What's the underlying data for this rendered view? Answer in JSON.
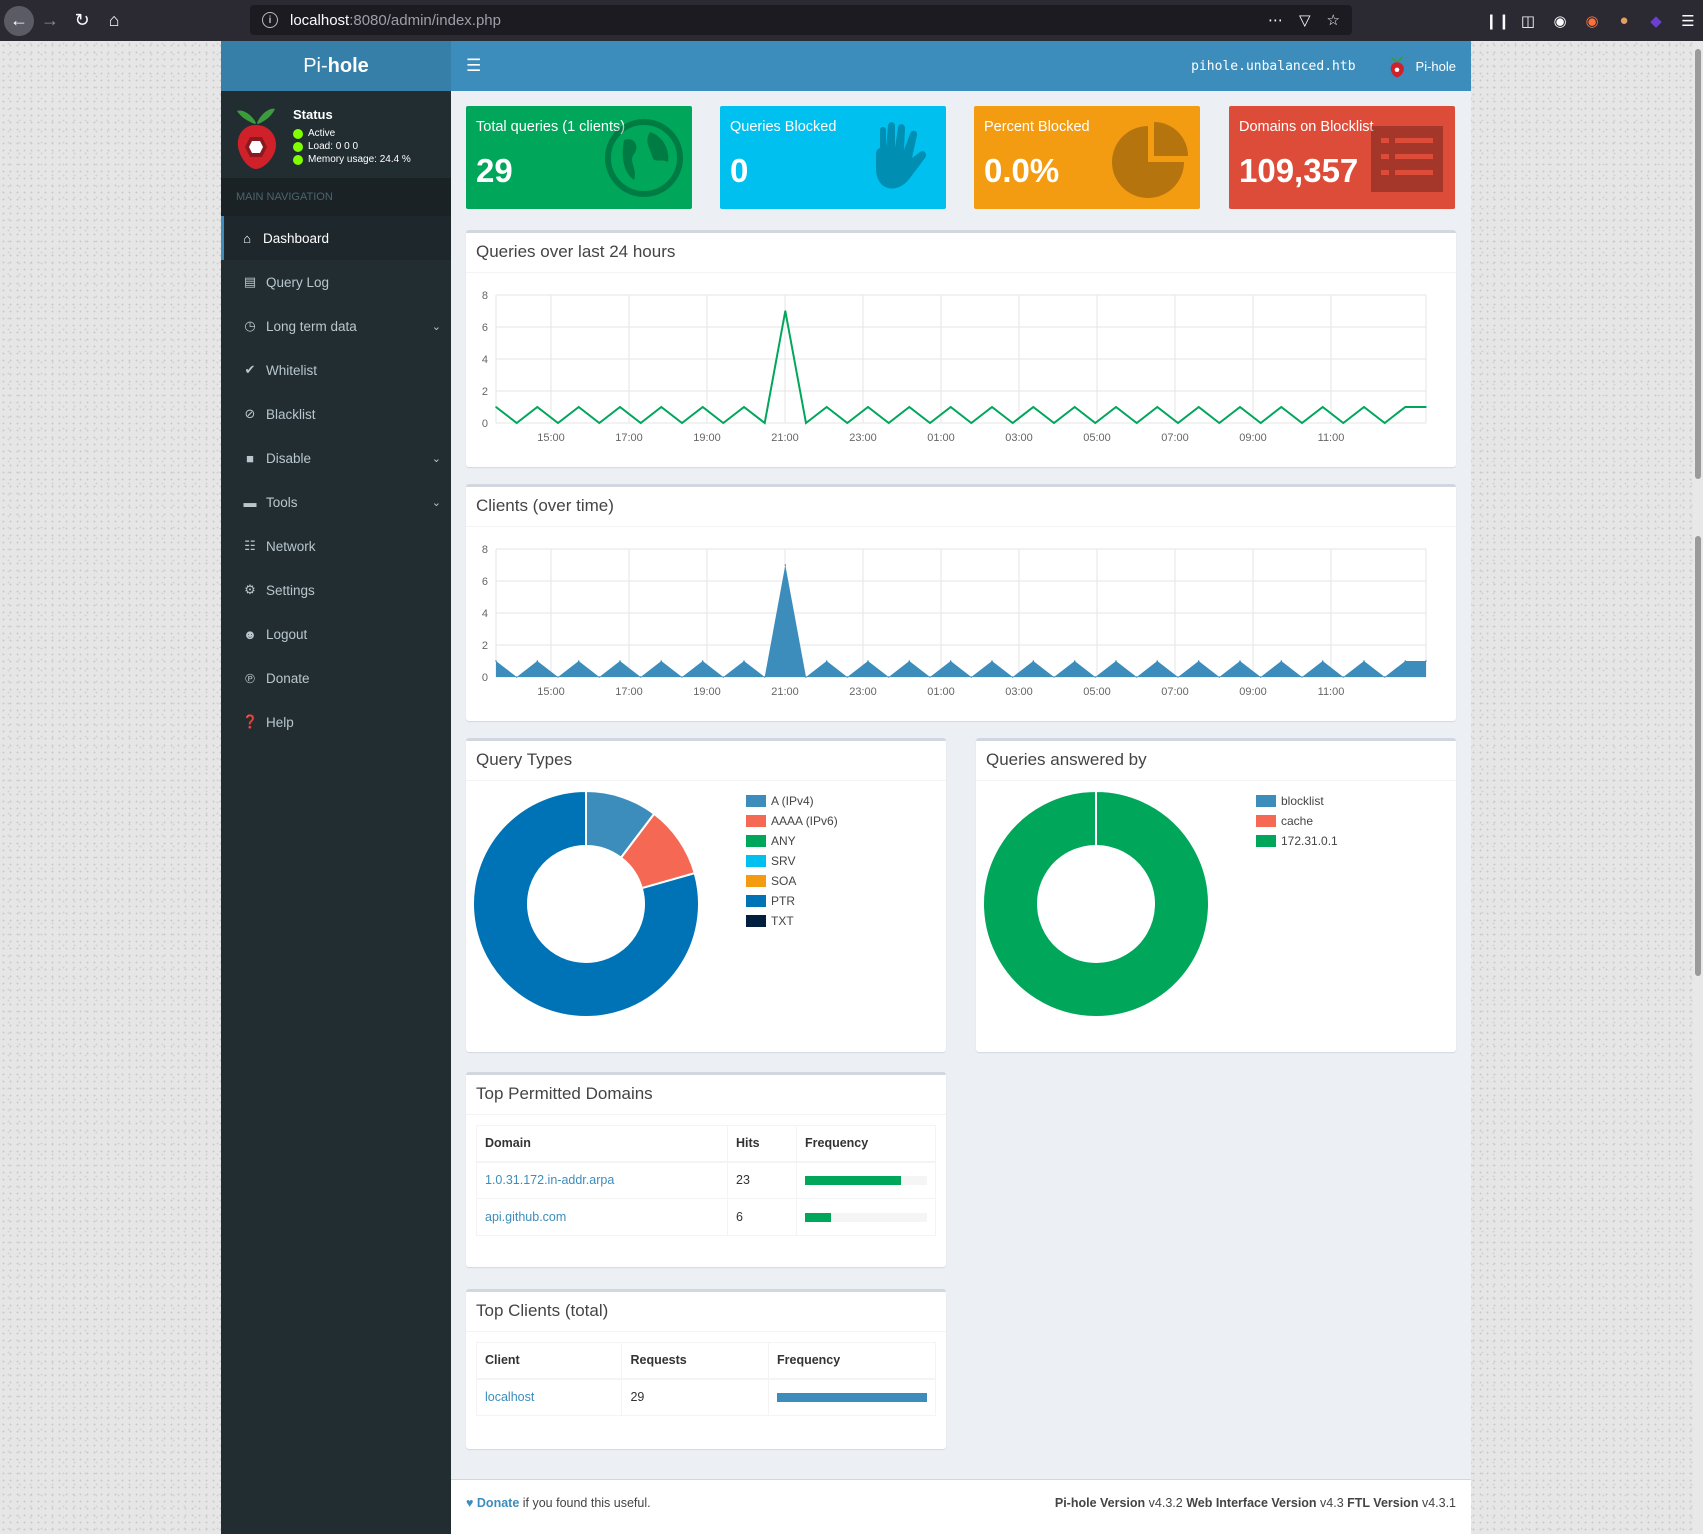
{
  "browser": {
    "url_host": "localhost",
    "url_rest": ":8080/admin/index.php"
  },
  "brand": {
    "logo_light": "Pi-",
    "logo_bold": "hole"
  },
  "status": {
    "title": "Status",
    "active": "Active",
    "load": "Load:  0  0  0",
    "memory": "Memory usage:  24.4 %"
  },
  "nav_header": "MAIN NAVIGATION",
  "nav": [
    {
      "label": "Dashboard",
      "icon": "home-icon"
    },
    {
      "label": "Query Log",
      "icon": "file-icon"
    },
    {
      "label": "Long term data",
      "icon": "clock-icon"
    },
    {
      "label": "Whitelist",
      "icon": "check-circle-icon"
    },
    {
      "label": "Blacklist",
      "icon": "ban-icon"
    },
    {
      "label": "Disable",
      "icon": "stop-icon"
    },
    {
      "label": "Tools",
      "icon": "folder-icon"
    },
    {
      "label": "Network",
      "icon": "network-icon"
    },
    {
      "label": "Settings",
      "icon": "gears-icon"
    },
    {
      "label": "Logout",
      "icon": "user-x-icon"
    },
    {
      "label": "Donate",
      "icon": "paypal-icon"
    },
    {
      "label": "Help",
      "icon": "question-icon"
    }
  ],
  "topbar": {
    "hostname": "pihole.unbalanced.htb",
    "user": "Pi-hole"
  },
  "stats": {
    "total_queries_label": "Total queries (1 clients)",
    "total_queries": "29",
    "blocked_label": "Queries Blocked",
    "blocked": "0",
    "percent_label": "Percent Blocked",
    "percent": "0.0%",
    "domains_label": "Domains on Blocklist",
    "domains": "109,357"
  },
  "colors": {
    "green": "#00a65a",
    "aqua": "#00c0ef",
    "yellow": "#f39c12",
    "red": "#dd4b39",
    "line_queries": "#00a65a",
    "line_clients": "#3c8dbc"
  },
  "chart_titles": {
    "queries": "Queries over last 24 hours",
    "clients": "Clients (over time)",
    "query_types": "Query Types",
    "answered_by": "Queries answered by"
  },
  "chart_data": [
    {
      "type": "line",
      "title": "Queries over last 24 hours",
      "x_ticks": [
        "15:00",
        "17:00",
        "19:00",
        "21:00",
        "23:00",
        "01:00",
        "03:00",
        "05:00",
        "07:00",
        "09:00",
        "11:00"
      ],
      "y_ticks": [
        0,
        2,
        4,
        6,
        8
      ],
      "ylim": [
        0,
        8
      ],
      "series": [
        {
          "values": [
            1,
            0,
            1,
            0,
            1,
            0,
            1,
            0,
            1,
            0,
            1,
            0,
            1,
            0,
            7,
            0,
            1,
            0,
            1,
            0,
            1,
            0,
            1,
            0,
            1,
            0,
            1,
            0,
            1,
            0,
            1,
            0,
            1,
            0,
            1,
            0,
            1,
            0,
            1,
            0,
            1,
            0,
            1,
            0,
            1,
            1
          ]
        }
      ]
    },
    {
      "type": "area",
      "title": "Clients (over time)",
      "x_ticks": [
        "15:00",
        "17:00",
        "19:00",
        "21:00",
        "23:00",
        "01:00",
        "03:00",
        "05:00",
        "07:00",
        "09:00",
        "11:00"
      ],
      "y_ticks": [
        0,
        2,
        4,
        6,
        8
      ],
      "ylim": [
        0,
        8
      ],
      "series": [
        {
          "values": [
            1,
            0,
            1,
            0,
            1,
            0,
            1,
            0,
            1,
            0,
            1,
            0,
            1,
            0,
            7,
            0,
            1,
            0,
            1,
            0,
            1,
            0,
            1,
            0,
            1,
            0,
            1,
            0,
            1,
            0,
            1,
            0,
            1,
            0,
            1,
            0,
            1,
            0,
            1,
            0,
            1,
            0,
            1,
            0,
            1,
            1
          ]
        }
      ]
    },
    {
      "type": "pie",
      "title": "Query Types",
      "categories": [
        "A (IPv4)",
        "AAAA (IPv6)",
        "ANY",
        "SRV",
        "SOA",
        "PTR",
        "TXT"
      ],
      "values": [
        10.3,
        10.3,
        0,
        0,
        0,
        79.4,
        0
      ],
      "colors": [
        "#3c8dbc",
        "#f56954",
        "#00a65a",
        "#00c0ef",
        "#f39c12",
        "#0073b7",
        "#001f3f"
      ]
    },
    {
      "type": "pie",
      "title": "Queries answered by",
      "categories": [
        "blocklist",
        "cache",
        "172.31.0.1"
      ],
      "values": [
        0,
        0,
        100
      ],
      "colors": [
        "#3c8dbc",
        "#f56954",
        "#00a65a"
      ]
    }
  ],
  "top_domains": {
    "title": "Top Permitted Domains",
    "headers": [
      "Domain",
      "Hits",
      "Frequency"
    ],
    "rows": [
      {
        "domain": "1.0.31.172.in-addr.arpa",
        "hits": "23",
        "freq": 0.79
      },
      {
        "domain": "api.github.com",
        "hits": "6",
        "freq": 0.21
      }
    ]
  },
  "top_clients": {
    "title": "Top Clients (total)",
    "headers": [
      "Client",
      "Requests",
      "Frequency"
    ],
    "rows": [
      {
        "client": "localhost",
        "requests": "29",
        "freq": 1.0
      }
    ]
  },
  "footer": {
    "donate": "Donate",
    "donate_rest": " if you found this useful.",
    "pihole_label": "Pi-hole Version",
    "pihole_ver": " v4.3.2 ",
    "web_label": "Web Interface Version",
    "web_ver": " v4.3 ",
    "ftl_label": "FTL Version",
    "ftl_ver": " v4.3.1"
  }
}
